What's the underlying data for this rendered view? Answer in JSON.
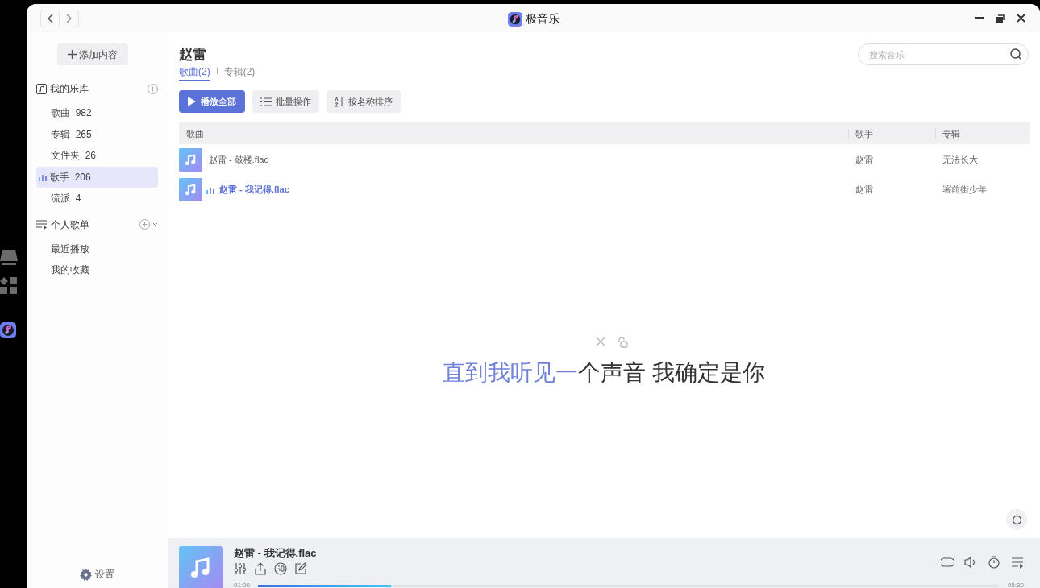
{
  "window": {
    "title": "极音乐"
  },
  "sidebar": {
    "add_button": "添加内容",
    "sections": [
      {
        "kind": "library",
        "title": "我的乐库",
        "items": [
          {
            "label": "歌曲",
            "count": "982",
            "selected": false
          },
          {
            "label": "专辑",
            "count": "265",
            "selected": false
          },
          {
            "label": "文件夹",
            "count": "26",
            "selected": false
          },
          {
            "label": "歌手",
            "count": "206",
            "selected": true
          },
          {
            "label": "流派",
            "count": "4",
            "selected": false
          }
        ]
      },
      {
        "kind": "playlists",
        "title": "个人歌单",
        "items": [
          {
            "label": "最近播放",
            "selected": false
          },
          {
            "label": "我的收藏",
            "selected": false
          }
        ]
      }
    ],
    "settings": "设置"
  },
  "search": {
    "placeholder": "搜索音乐"
  },
  "artist": {
    "name": "赵雷",
    "tabs": [
      {
        "label": "歌曲(2)",
        "selected": true
      },
      {
        "label": "专辑(2)",
        "selected": false
      }
    ]
  },
  "actions": [
    {
      "kind": "play",
      "label": "播放全部"
    },
    {
      "kind": "batch",
      "label": "批量操作"
    },
    {
      "kind": "sort",
      "label": "按名称排序"
    }
  ],
  "table": {
    "columns": [
      "歌曲",
      "歌手",
      "专辑"
    ],
    "rows": [
      {
        "title": "赵雷 - 鼓楼.flac",
        "artist": "赵雷",
        "album": "无法长大",
        "playing": false
      },
      {
        "title": "赵雷 - 我记得.flac",
        "artist": "赵雷",
        "album": "署前街少年",
        "playing": true
      }
    ]
  },
  "lyric": {
    "sung": "直到我听见一",
    "rest": "个声音 我确定是你"
  },
  "player": {
    "title": "赵雷 - 我记得.flac",
    "elapsed": "01:00",
    "duration": "05:30",
    "level": 0.18
  }
}
